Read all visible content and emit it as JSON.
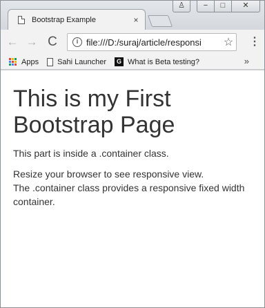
{
  "browser": {
    "tab_title": "Bootstrap Example",
    "tab_close": "×",
    "address": "file:///D:/suraj/article/responsi",
    "info": "i",
    "star": "☆",
    "back": "←",
    "forward": "→",
    "reload": "C",
    "menu": "⋮",
    "window_controls": {
      "user": "♙",
      "minimize": "−",
      "maximize": "□",
      "close": "✕"
    }
  },
  "bookmarks": {
    "items": [
      {
        "label": "Apps",
        "icon": "apps-grid-icon"
      },
      {
        "label": "Sahi Launcher",
        "icon": "page-icon"
      },
      {
        "label": "What is Beta testing?",
        "icon": "g-logo-icon"
      }
    ],
    "overflow": "»",
    "apps_colors": [
      "#db4437",
      "#f4b400",
      "#0f9d58",
      "#4285f4",
      "#db4437",
      "#f4b400",
      "#0f9d58",
      "#4285f4",
      "#db4437"
    ]
  },
  "page": {
    "heading": "This is my First Bootstrap Page",
    "para1": "This part is inside a .container class.",
    "para2_line1": "Resize your browser to see responsive view.",
    "para2_line2": "The .container class provides a responsive fixed width container."
  }
}
